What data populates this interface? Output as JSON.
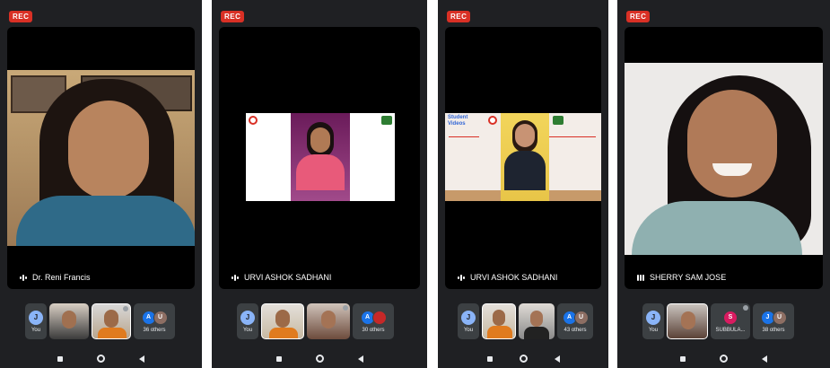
{
  "rec_label": "REC",
  "you_label": "You",
  "you_initial": "J",
  "panels": [
    {
      "speaker": "Dr. Reni Francis",
      "others_label": "36 others",
      "others_avatars": [
        {
          "letter": "A",
          "color": "#1a73e8"
        },
        {
          "letter": "U",
          "color": "#8d6e63"
        }
      ]
    },
    {
      "speaker": "URVI ASHOK SADHANI",
      "others_label": "30 others",
      "others_avatars": [
        {
          "letter": "A",
          "color": "#1a73e8"
        },
        {
          "letter": "",
          "color": "#c62828"
        }
      ]
    },
    {
      "speaker": "URVI ASHOK SADHANI",
      "others_label": "43 others",
      "slide_title": "Student Videos",
      "others_avatars": [
        {
          "letter": "A",
          "color": "#1a73e8"
        },
        {
          "letter": "U",
          "color": "#8d6e63"
        }
      ]
    },
    {
      "speaker": "SHERRY SAM JOSE",
      "participant_tile_initial": "S",
      "participant_tile_name": "SUBBULA...",
      "others_label": "38 others",
      "others_avatars": [
        {
          "letter": "J",
          "color": "#1a73e8"
        },
        {
          "letter": "U",
          "color": "#8d6e63"
        }
      ]
    }
  ]
}
